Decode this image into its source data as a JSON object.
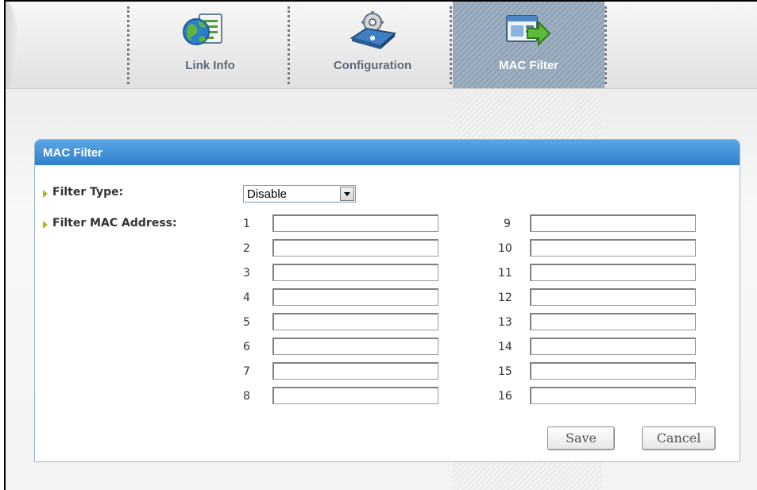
{
  "nav": {
    "tabs": [
      {
        "label": "Link Info",
        "icon": "globe-document-icon"
      },
      {
        "label": "Configuration",
        "icon": "router-gear-icon"
      },
      {
        "label": "MAC Filter",
        "icon": "filter-arrow-icon"
      }
    ],
    "active_tab": "MAC Filter"
  },
  "panel": {
    "title": "MAC Filter",
    "filter_type_label": "Filter Type:",
    "filter_type_value": "Disable",
    "filter_mac_label": "Filter MAC Address:",
    "mac_fields_left": [
      {
        "n": "1",
        "value": ""
      },
      {
        "n": "2",
        "value": ""
      },
      {
        "n": "3",
        "value": ""
      },
      {
        "n": "4",
        "value": ""
      },
      {
        "n": "5",
        "value": ""
      },
      {
        "n": "6",
        "value": ""
      },
      {
        "n": "7",
        "value": ""
      },
      {
        "n": "8",
        "value": ""
      }
    ],
    "mac_fields_right": [
      {
        "n": "9",
        "value": ""
      },
      {
        "n": "10",
        "value": ""
      },
      {
        "n": "11",
        "value": ""
      },
      {
        "n": "12",
        "value": ""
      },
      {
        "n": "13",
        "value": ""
      },
      {
        "n": "14",
        "value": ""
      },
      {
        "n": "15",
        "value": ""
      },
      {
        "n": "16",
        "value": ""
      }
    ]
  },
  "buttons": {
    "save": "Save",
    "cancel": "Cancel"
  },
  "colors": {
    "panel_header": "#3b8bd6",
    "bullet": "#9bc51b",
    "active_tab": "#97aabb"
  }
}
